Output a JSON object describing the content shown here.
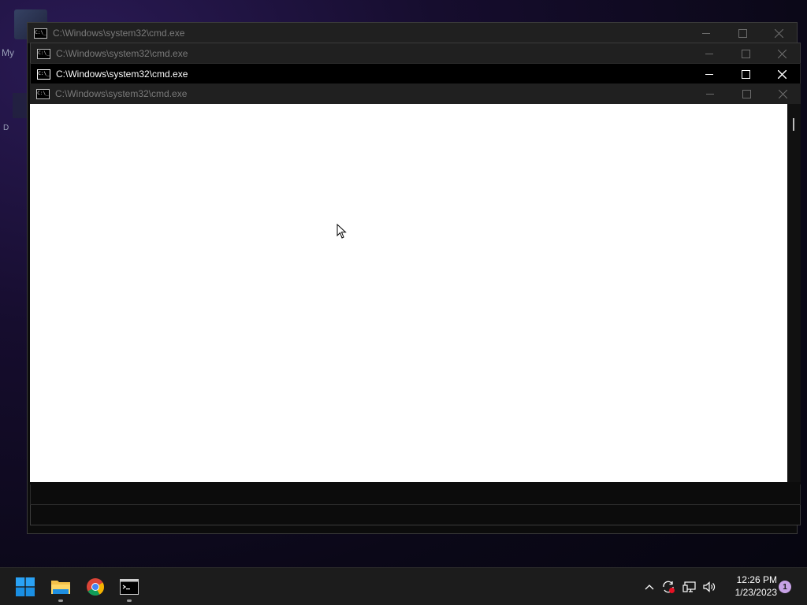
{
  "windows": [
    {
      "title": "C:\\Windows\\system32\\cmd.exe",
      "icon": "cmd-icon",
      "state": "inactive"
    },
    {
      "title": "C:\\Windows\\system32\\cmd.exe",
      "icon": "cmd-icon",
      "state": "inactive"
    },
    {
      "title": "C:\\Windows\\system32\\cmd.exe",
      "icon": "cmd-icon",
      "state": "active"
    },
    {
      "title": "C:\\Windows\\system32\\cmd.exe",
      "icon": "cmd-icon",
      "state": "inactive"
    }
  ],
  "window_icon_text": "C:\\_",
  "desktop": {
    "label_a": "My",
    "label_b": "D"
  },
  "taskbar": {
    "apps": [
      {
        "name": "start",
        "icon": "windows-logo-icon"
      },
      {
        "name": "file-explorer",
        "icon": "folder-icon"
      },
      {
        "name": "chrome",
        "icon": "chrome-icon"
      },
      {
        "name": "command-prompt",
        "icon": "cmd-icon"
      }
    ],
    "tray": {
      "time": "12:26 PM",
      "date": "1/23/2023",
      "notification_count": "1"
    }
  },
  "colors": {
    "taskbar_bg": "#1c1c1c",
    "active_title_bg": "#000000",
    "inactive_title_bg": "#202020",
    "console_bg": "#ffffff",
    "accent_start": "#0078d4"
  }
}
